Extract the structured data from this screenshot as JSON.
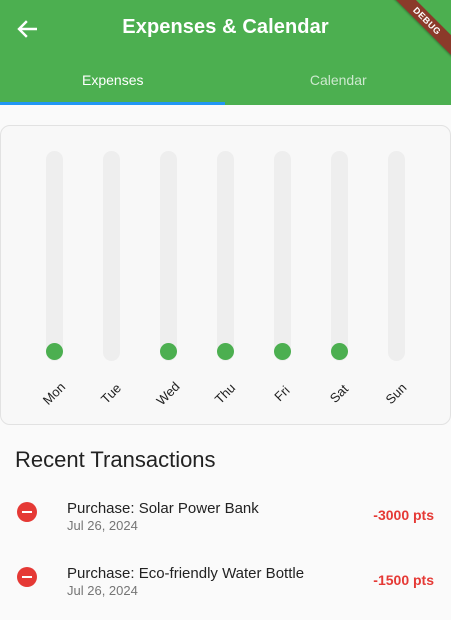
{
  "appbar": {
    "title": "Expenses & Calendar",
    "back_icon": "arrow-back-icon",
    "debug_label": "DEBUG",
    "color": "#4caf50"
  },
  "tabs": [
    {
      "label": "Expenses",
      "active": true
    },
    {
      "label": "Calendar",
      "active": false
    }
  ],
  "tab_indicator_color": "#2196f3",
  "chart": {
    "days": [
      {
        "label": "Mon",
        "has_entry": true
      },
      {
        "label": "Tue",
        "has_entry": false
      },
      {
        "label": "Wed",
        "has_entry": true
      },
      {
        "label": "Thu",
        "has_entry": true
      },
      {
        "label": "Fri",
        "has_entry": true
      },
      {
        "label": "Sat",
        "has_entry": true
      },
      {
        "label": "Sun",
        "has_entry": false
      }
    ],
    "dot_color": "#4caf50"
  },
  "transactions": {
    "title": "Recent Transactions",
    "items": [
      {
        "title": "Purchase: Solar Power Bank",
        "date": "Jul 26, 2024",
        "amount": "-3000 pts",
        "icon": "remove-circle-icon"
      },
      {
        "title": "Purchase: Eco-friendly Water Bottle",
        "date": "Jul 26, 2024",
        "amount": "-1500 pts",
        "icon": "remove-circle-icon"
      }
    ],
    "amount_color": "#e53935"
  }
}
